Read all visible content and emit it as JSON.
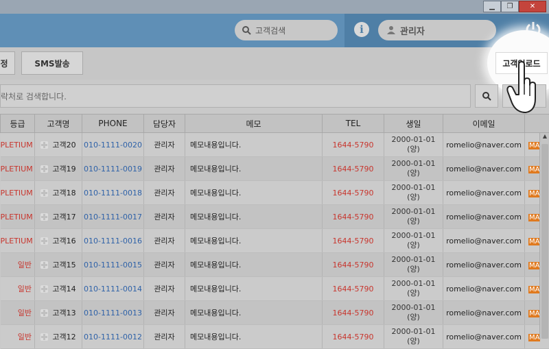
{
  "toolbar": {
    "btn_partial": "정",
    "sms_label": "SMS발송",
    "upload_label": "고객업로드"
  },
  "header": {
    "search_placeholder": "고객검색",
    "user_label": "관리자"
  },
  "search": {
    "placeholder": "락처로 검색합니다."
  },
  "table": {
    "headers": [
      "등급",
      "고객명",
      "PHONE",
      "담당자",
      "메모",
      "TEL",
      "생일",
      "이메일",
      ""
    ],
    "rows": [
      {
        "grade": "PLETIUM",
        "name": "고객20",
        "phone": "010-1111-0020",
        "manager": "관리자",
        "memo": "메모내용입니다.",
        "tel": "1644-5790",
        "birth1": "2000-01-01",
        "birth2": "(양)",
        "email": "romelio@naver.com",
        "badge": "MA"
      },
      {
        "grade": "PLETIUM",
        "name": "고객19",
        "phone": "010-1111-0019",
        "manager": "관리자",
        "memo": "메모내용입니다.",
        "tel": "1644-5790",
        "birth1": "2000-01-01",
        "birth2": "(양)",
        "email": "romelio@naver.com",
        "badge": "MA"
      },
      {
        "grade": "PLETIUM",
        "name": "고객18",
        "phone": "010-1111-0018",
        "manager": "관리자",
        "memo": "메모내용입니다.",
        "tel": "1644-5790",
        "birth1": "2000-01-01",
        "birth2": "(양)",
        "email": "romelio@naver.com",
        "badge": "MA"
      },
      {
        "grade": "PLETIUM",
        "name": "고객17",
        "phone": "010-1111-0017",
        "manager": "관리자",
        "memo": "메모내용입니다.",
        "tel": "1644-5790",
        "birth1": "2000-01-01",
        "birth2": "(양)",
        "email": "romelio@naver.com",
        "badge": "MA"
      },
      {
        "grade": "PLETIUM",
        "name": "고객16",
        "phone": "010-1111-0016",
        "manager": "관리자",
        "memo": "메모내용입니다.",
        "tel": "1644-5790",
        "birth1": "2000-01-01",
        "birth2": "(양)",
        "email": "romelio@naver.com",
        "badge": "MA"
      },
      {
        "grade": "일반",
        "name": "고객15",
        "phone": "010-1111-0015",
        "manager": "관리자",
        "memo": "메모내용입니다.",
        "tel": "1644-5790",
        "birth1": "2000-01-01",
        "birth2": "(양)",
        "email": "romelio@naver.com",
        "badge": "MA"
      },
      {
        "grade": "일반",
        "name": "고객14",
        "phone": "010-1111-0014",
        "manager": "관리자",
        "memo": "메모내용입니다.",
        "tel": "1644-5790",
        "birth1": "2000-01-01",
        "birth2": "(양)",
        "email": "romelio@naver.com",
        "badge": "MA"
      },
      {
        "grade": "일반",
        "name": "고객13",
        "phone": "010-1111-0013",
        "manager": "관리자",
        "memo": "메모내용입니다.",
        "tel": "1644-5790",
        "birth1": "2000-01-01",
        "birth2": "(양)",
        "email": "romelio@naver.com",
        "badge": "MA"
      },
      {
        "grade": "일반",
        "name": "고객12",
        "phone": "010-1111-0012",
        "manager": "관리자",
        "memo": "메모내용입니다.",
        "tel": "1644-5790",
        "birth1": "2000-01-01",
        "birth2": "(양)",
        "email": "romelio@naver.com",
        "badge": "MA"
      }
    ]
  },
  "colors": {
    "header_blue": "#5f8fb6",
    "grade_red": "#c8342c",
    "phone_blue": "#2f62a8",
    "badge_orange": "#e07a1f"
  },
  "icons": {
    "search": "search-icon",
    "info": "info-icon",
    "user": "user-icon",
    "power": "power-icon",
    "hand": "hand-cursor-icon"
  }
}
